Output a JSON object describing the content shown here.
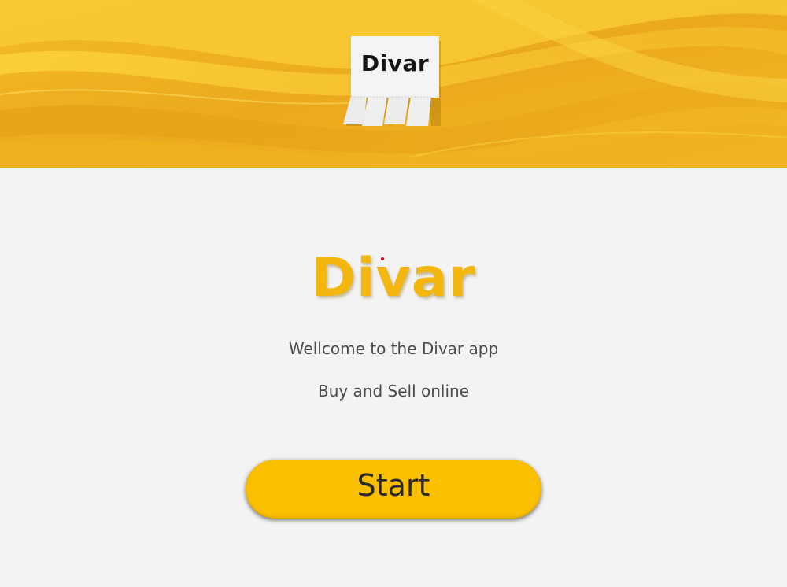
{
  "logo": {
    "label": "Divar"
  },
  "brand": {
    "title": "Divar"
  },
  "text": {
    "welcome": "Wellcome to the Divar app",
    "tagline": "Buy and Sell online"
  },
  "start_button": {
    "label": "Start"
  },
  "colors": {
    "banner_yellow": "#f2b822",
    "brand_yellow": "#f3b70f",
    "button_yellow": "#fbbf02",
    "background": "#f3f3f3"
  }
}
